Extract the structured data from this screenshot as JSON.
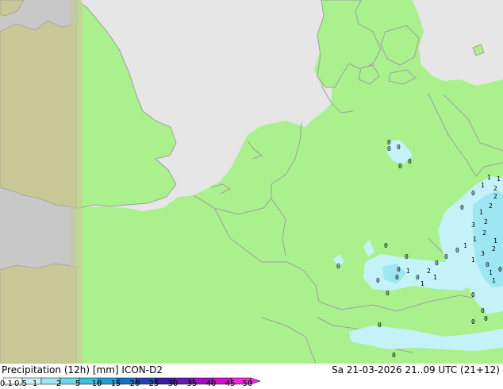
{
  "legend": {
    "title": "Precipitation (12h) [mm] ICON-D2",
    "ticks": [
      "0.1",
      "0.5",
      "1",
      "2",
      "5",
      "10",
      "15",
      "20",
      "25",
      "30",
      "35",
      "40",
      "45",
      "50"
    ],
    "colors": [
      "#ffffff",
      "#c4f2f8",
      "#9ee6f1",
      "#6bd4e8",
      "#3cbfe0",
      "#1f9fd4",
      "#1a70c4",
      "#2244b0",
      "#3a1ea0",
      "#6a18b0",
      "#a010c0",
      "#d010d0",
      "#f028e0"
    ]
  },
  "valid_time": "Sa 21-03-2026 21..09 UTC (21+12)",
  "map_colors": {
    "land_in_domain": "#aaf08c",
    "sea": "#e6e6e6",
    "outside_domain": "#c8c8c8",
    "land_outside_domain": "#c8c896",
    "precip_light": "#c4f2f8",
    "precip_medium": "#9ee6f1"
  },
  "precip_labels": {
    "north_cluster": [
      "0",
      "0",
      "0",
      "0",
      "0"
    ],
    "east_cluster": [
      "1",
      "1",
      "2",
      "2",
      "2",
      "1",
      "2",
      "3",
      "2",
      "1",
      "1",
      "1",
      "2",
      "3",
      "1",
      "0",
      "1",
      "1",
      "1",
      "0",
      "0",
      "0",
      "0"
    ],
    "south_cluster": [
      "0",
      "0",
      "0",
      "1",
      "0",
      "2",
      "0",
      "1",
      "0",
      "1",
      "0",
      "0",
      "0",
      "0"
    ],
    "alps_cluster": [
      "0",
      "0",
      "0",
      "0",
      "0",
      "0"
    ]
  }
}
